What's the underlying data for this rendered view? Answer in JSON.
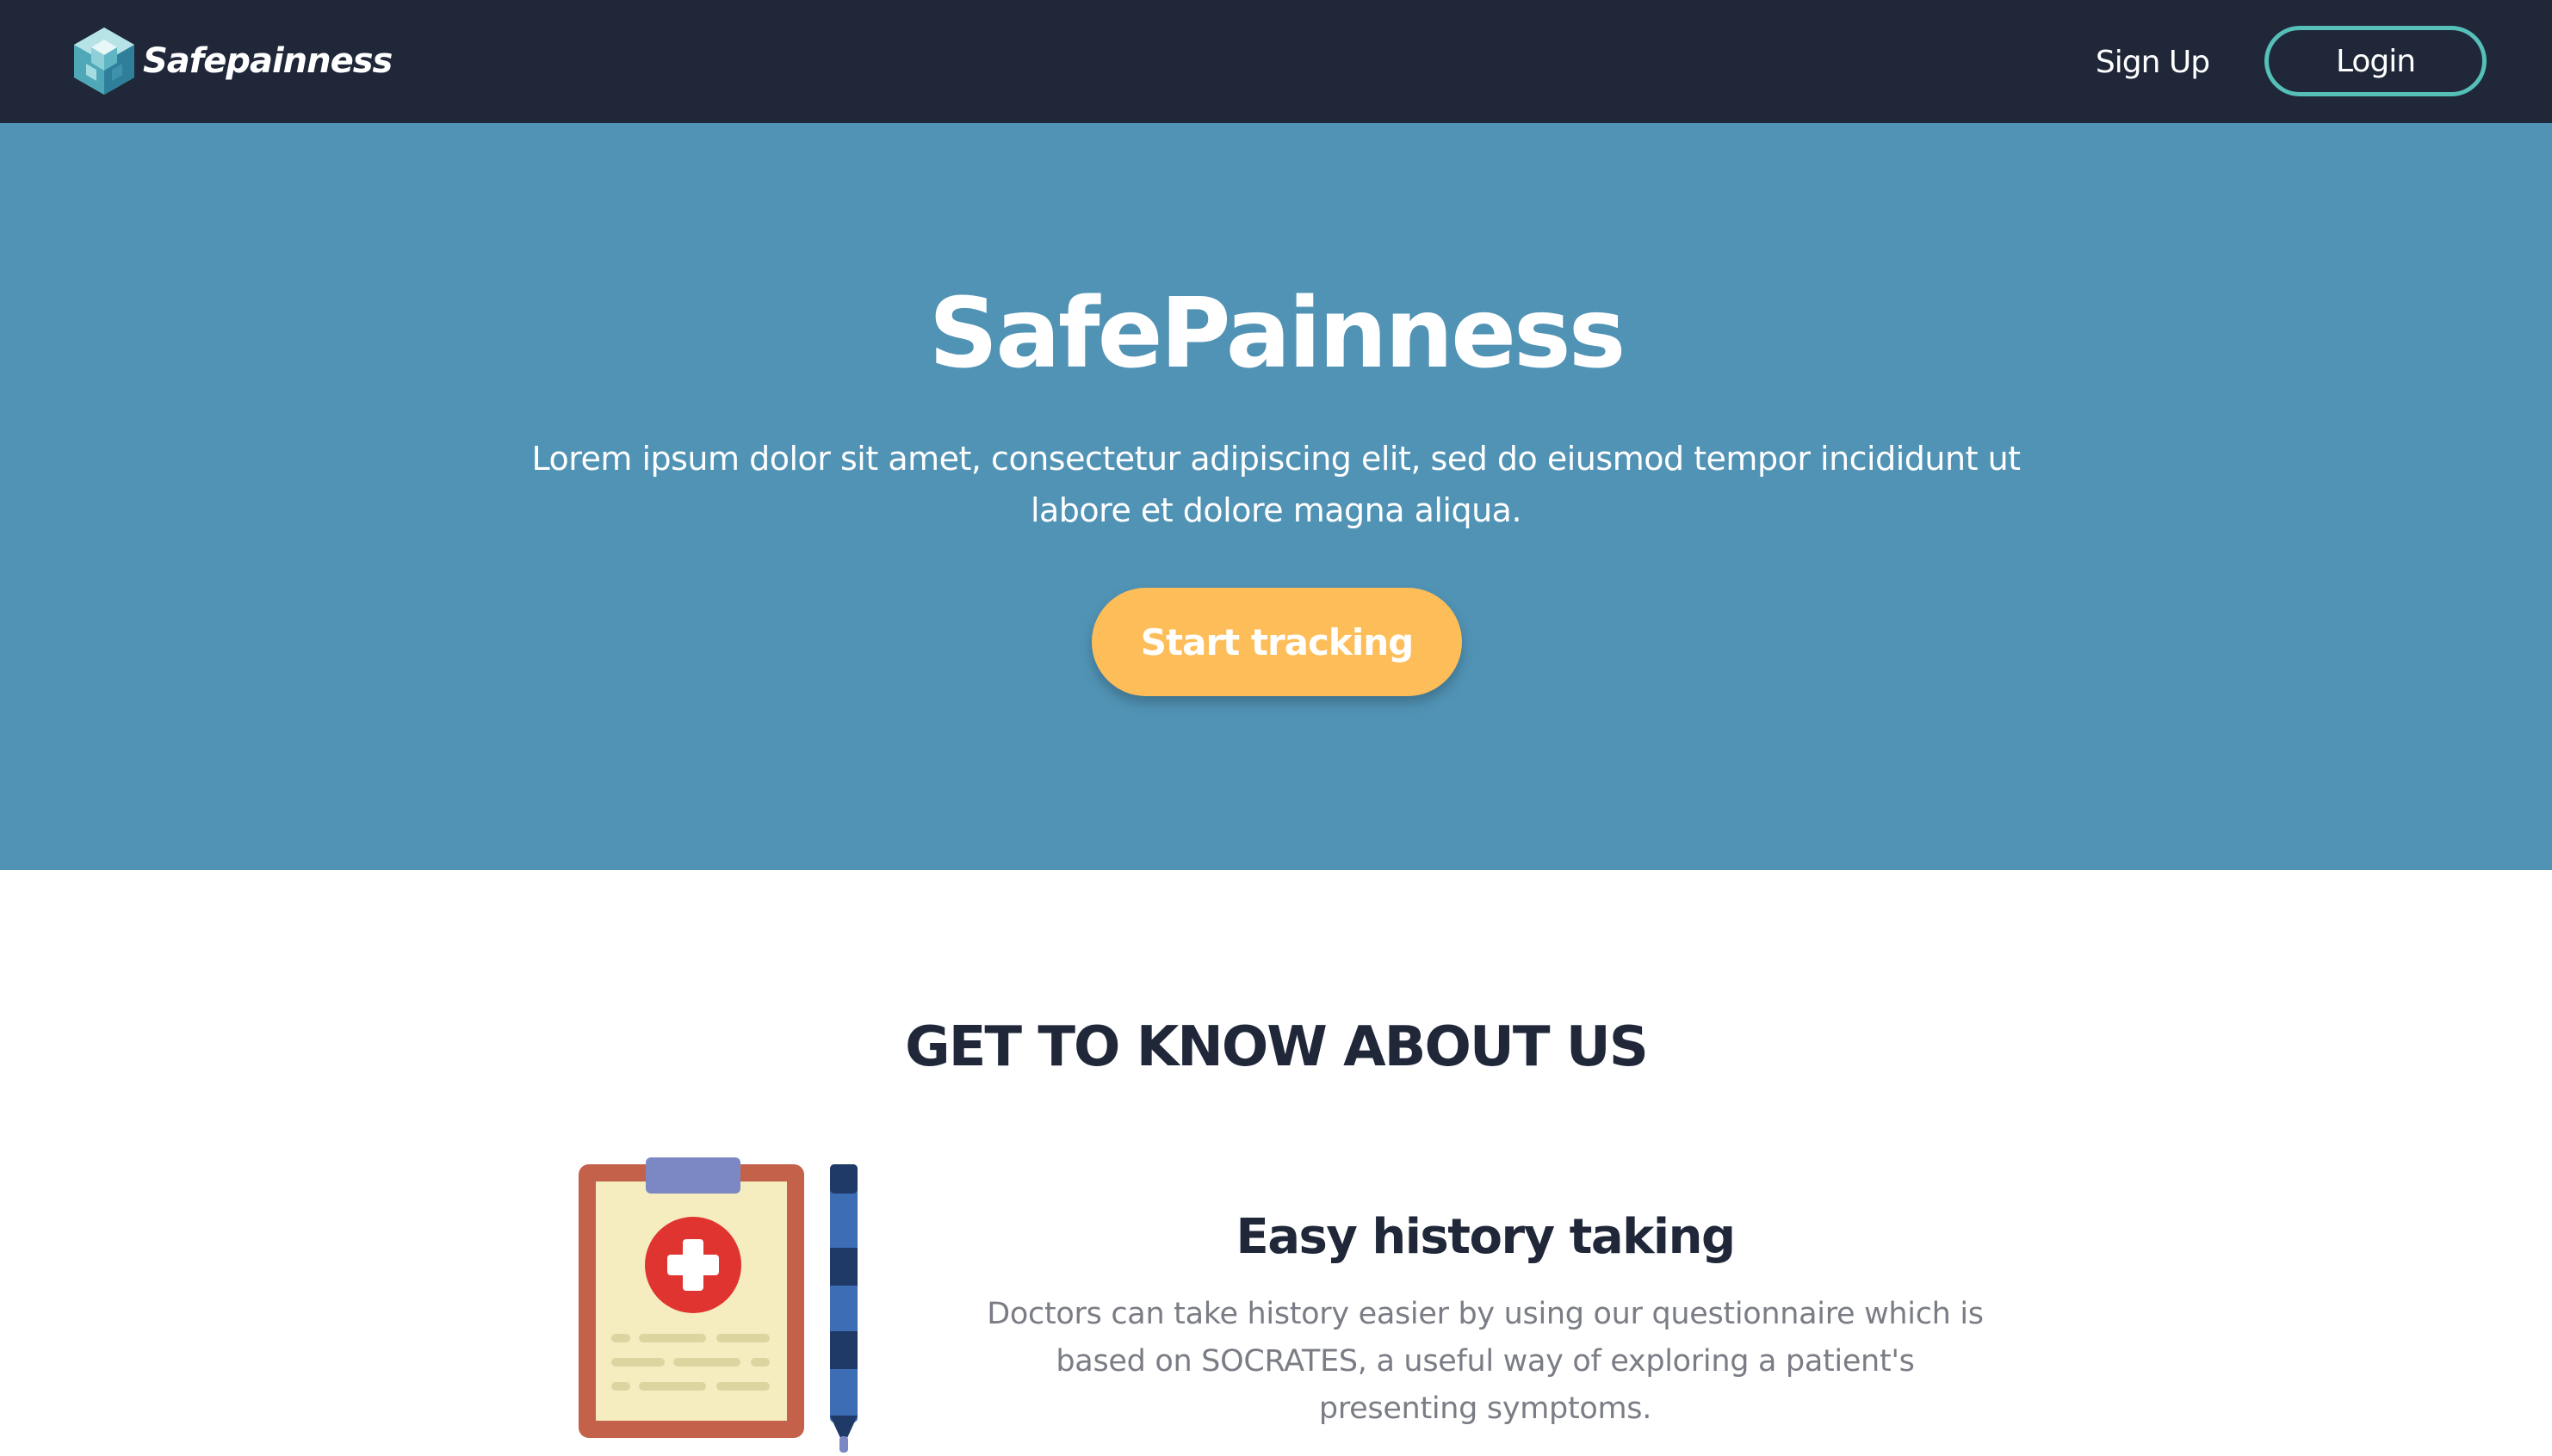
{
  "navbar": {
    "brand_name": "Safepainness",
    "logo_icon": "hexagon-cubes-logo",
    "signup_label": "Sign Up",
    "login_label": "Login",
    "colors": {
      "background": "#1f2739",
      "login_border": "#55bfb8"
    }
  },
  "hero": {
    "title": "SafePainness",
    "text": "Lorem ipsum dolor sit amet, consectetur adipiscing elit, sed do eiusmod tempor incididunt ut labore et dolore magna aliqua.",
    "cta_label": "Start tracking",
    "colors": {
      "background": "#5193b5",
      "cta": "#fdbd59"
    }
  },
  "about": {
    "heading": "GET TO KNOW ABOUT US",
    "features": [
      {
        "icon": "clipboard-medical-icon",
        "secondary_icon": "pen-icon",
        "title": "Easy history taking",
        "text": "Doctors can take history easier by using our questionnaire which is based on SOCRATES, a useful way of exploring a patient's presenting symptoms."
      }
    ]
  }
}
